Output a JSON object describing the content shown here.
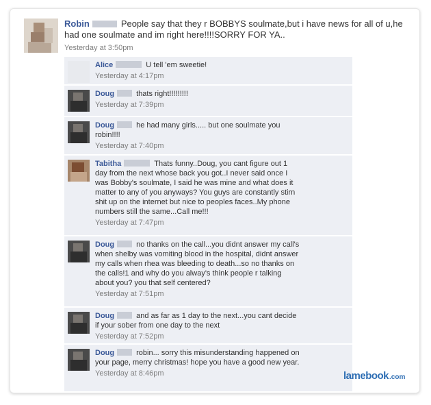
{
  "post": {
    "author": "Robin",
    "text": "People say that they r BOBBYS soulmate,but i have news for all of u,he had one soulmate and im right here!!!!SORRY FOR YA..",
    "timestamp": "Yesterday at 3:50pm"
  },
  "comments": [
    {
      "author": "Alice",
      "text": "U tell 'em sweetie!",
      "timestamp": "Yesterday at 4:17pm"
    },
    {
      "author": "Doug",
      "text": "thats right!!!!!!!!!",
      "timestamp": "Yesterday at 7:39pm"
    },
    {
      "author": "Doug",
      "text": "he had many girls..... but one soulmate you robin!!!!",
      "timestamp": "Yesterday at 7:40pm"
    },
    {
      "author": "Tabitha",
      "text": "Thats funny..Doug, you cant figure out 1 day from the next whose back you got..I never said once I was Bobby's soulmate, I said he was mine and what does it matter to any of you anyways? You guys are constantly stirn shit up on the internet but nice to peoples faces..My phone numbers still the same...Call me!!!",
      "timestamp": "Yesterday at 7:47pm"
    },
    {
      "author": "Doug",
      "text": "no thanks on the call...you didnt answer my call's when shelby was vomiting blood in the hospital, didnt answer my calls when rhea was bleeding to death...so no thanks on the calls!1 and why do you alway's think people r talking about you? you that self centered?",
      "timestamp": "Yesterday at 7:51pm"
    },
    {
      "author": "Doug",
      "text": "and as far as 1 day to the next...you cant decide if your sober from one day to the next",
      "timestamp": "Yesterday at 7:52pm"
    },
    {
      "author": "Doug",
      "text": "robin... sorry this misunderstanding happened on your page, merry christmas! hope you have a good new year.",
      "timestamp": "Yesterday at 8:46pm"
    }
  ],
  "watermark": {
    "main": "lamebook",
    "suffix": ".com"
  }
}
